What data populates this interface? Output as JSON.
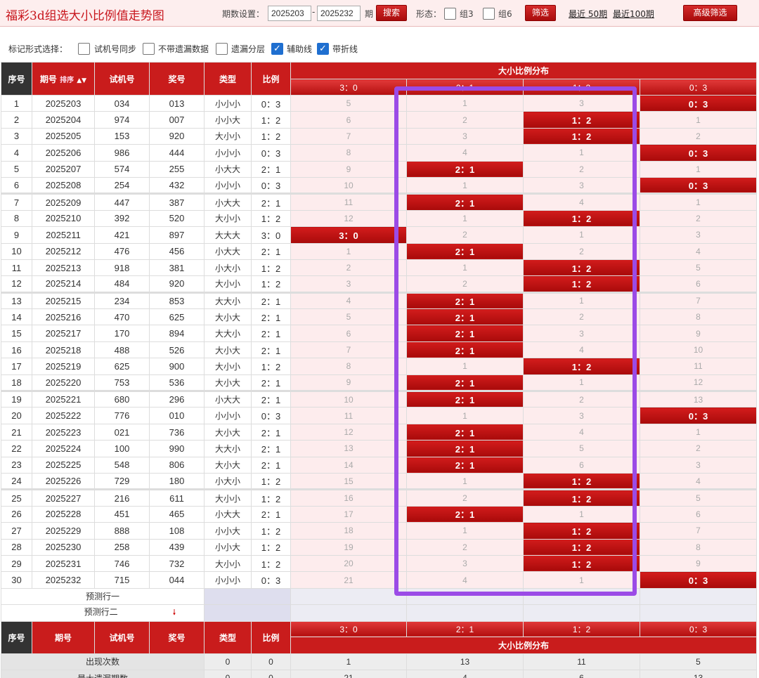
{
  "header": {
    "title": "福彩3d组选大小比例值走势图",
    "period_label": "期数设置：",
    "period_from": "2025203",
    "dash": "-",
    "period_to": "2025232",
    "period_unit": "期",
    "search_label": "搜索",
    "form_label": "形态：",
    "group3_label": "组3",
    "group6_label": "组6",
    "filter_label": "筛选",
    "recent50": "最近 50期",
    "recent100": "最近100期",
    "advanced_label": "高级筛选"
  },
  "options": {
    "label": "标记形式选择：",
    "items": [
      {
        "label": "试机号同步",
        "checked": false
      },
      {
        "label": "不带遗漏数据",
        "checked": false
      },
      {
        "label": "遗漏分层",
        "checked": false
      },
      {
        "label": "辅助线",
        "checked": true
      },
      {
        "label": "带折线",
        "checked": true
      }
    ]
  },
  "table": {
    "headers": {
      "seq": "序号",
      "period": "期号",
      "sort": "排序",
      "test": "试机号",
      "prize": "奖号",
      "type": "类型",
      "ratio": "比例",
      "dist": "大小比例分布"
    },
    "dist_cols": [
      "3：0",
      "2：1",
      "1：2",
      "0：3"
    ],
    "rows": [
      {
        "n": "1",
        "p": "2025203",
        "t": "034",
        "w": "013",
        "k": "小小小",
        "r": "0：3",
        "d": [
          "5",
          "1",
          "3",
          "0：3"
        ],
        "h": 3
      },
      {
        "n": "2",
        "p": "2025204",
        "t": "974",
        "w": "007",
        "k": "小小大",
        "r": "1：2",
        "d": [
          "6",
          "2",
          "1：2",
          "1"
        ],
        "h": 2
      },
      {
        "n": "3",
        "p": "2025205",
        "t": "153",
        "w": "920",
        "k": "大小小",
        "r": "1：2",
        "d": [
          "7",
          "3",
          "1：2",
          "2"
        ],
        "h": 2
      },
      {
        "n": "4",
        "p": "2025206",
        "t": "986",
        "w": "444",
        "k": "小小小",
        "r": "0：3",
        "d": [
          "8",
          "4",
          "1",
          "0：3"
        ],
        "h": 3
      },
      {
        "n": "5",
        "p": "2025207",
        "t": "574",
        "w": "255",
        "k": "小大大",
        "r": "2：1",
        "d": [
          "9",
          "2：1",
          "2",
          "1"
        ],
        "h": 1
      },
      {
        "n": "6",
        "p": "2025208",
        "t": "254",
        "w": "432",
        "k": "小小小",
        "r": "0：3",
        "d": [
          "10",
          "1",
          "3",
          "0：3"
        ],
        "h": 3
      },
      {
        "n": "7",
        "p": "2025209",
        "t": "447",
        "w": "387",
        "k": "小大大",
        "r": "2：1",
        "d": [
          "11",
          "2：1",
          "4",
          "1"
        ],
        "h": 1
      },
      {
        "n": "8",
        "p": "2025210",
        "t": "392",
        "w": "520",
        "k": "大小小",
        "r": "1：2",
        "d": [
          "12",
          "1",
          "1：2",
          "2"
        ],
        "h": 2
      },
      {
        "n": "9",
        "p": "2025211",
        "t": "421",
        "w": "897",
        "k": "大大大",
        "r": "3：0",
        "d": [
          "3：0",
          "2",
          "1",
          "3"
        ],
        "h": 0
      },
      {
        "n": "10",
        "p": "2025212",
        "t": "476",
        "w": "456",
        "k": "小大大",
        "r": "2：1",
        "d": [
          "1",
          "2：1",
          "2",
          "4"
        ],
        "h": 1
      },
      {
        "n": "11",
        "p": "2025213",
        "t": "918",
        "w": "381",
        "k": "小大小",
        "r": "1：2",
        "d": [
          "2",
          "1",
          "1：2",
          "5"
        ],
        "h": 2
      },
      {
        "n": "12",
        "p": "2025214",
        "t": "484",
        "w": "920",
        "k": "大小小",
        "r": "1：2",
        "d": [
          "3",
          "2",
          "1：2",
          "6"
        ],
        "h": 2
      },
      {
        "n": "13",
        "p": "2025215",
        "t": "234",
        "w": "853",
        "k": "大大小",
        "r": "2：1",
        "d": [
          "4",
          "2：1",
          "1",
          "7"
        ],
        "h": 1
      },
      {
        "n": "14",
        "p": "2025216",
        "t": "470",
        "w": "625",
        "k": "大小大",
        "r": "2：1",
        "d": [
          "5",
          "2：1",
          "2",
          "8"
        ],
        "h": 1
      },
      {
        "n": "15",
        "p": "2025217",
        "t": "170",
        "w": "894",
        "k": "大大小",
        "r": "2：1",
        "d": [
          "6",
          "2：1",
          "3",
          "9"
        ],
        "h": 1
      },
      {
        "n": "16",
        "p": "2025218",
        "t": "488",
        "w": "526",
        "k": "大小大",
        "r": "2：1",
        "d": [
          "7",
          "2：1",
          "4",
          "10"
        ],
        "h": 1
      },
      {
        "n": "17",
        "p": "2025219",
        "t": "625",
        "w": "900",
        "k": "大小小",
        "r": "1：2",
        "d": [
          "8",
          "1",
          "1：2",
          "11"
        ],
        "h": 2
      },
      {
        "n": "18",
        "p": "2025220",
        "t": "753",
        "w": "536",
        "k": "大小大",
        "r": "2：1",
        "d": [
          "9",
          "2：1",
          "1",
          "12"
        ],
        "h": 1
      },
      {
        "n": "19",
        "p": "2025221",
        "t": "680",
        "w": "296",
        "k": "小大大",
        "r": "2：1",
        "d": [
          "10",
          "2：1",
          "2",
          "13"
        ],
        "h": 1
      },
      {
        "n": "20",
        "p": "2025222",
        "t": "776",
        "w": "010",
        "k": "小小小",
        "r": "0：3",
        "d": [
          "11",
          "1",
          "3",
          "0：3"
        ],
        "h": 3
      },
      {
        "n": "21",
        "p": "2025223",
        "t": "021",
        "w": "736",
        "k": "大小大",
        "r": "2：1",
        "d": [
          "12",
          "2：1",
          "4",
          "1"
        ],
        "h": 1
      },
      {
        "n": "22",
        "p": "2025224",
        "t": "100",
        "w": "990",
        "k": "大大小",
        "r": "2：1",
        "d": [
          "13",
          "2：1",
          "5",
          "2"
        ],
        "h": 1
      },
      {
        "n": "23",
        "p": "2025225",
        "t": "548",
        "w": "806",
        "k": "大小大",
        "r": "2：1",
        "d": [
          "14",
          "2：1",
          "6",
          "3"
        ],
        "h": 1
      },
      {
        "n": "24",
        "p": "2025226",
        "t": "729",
        "w": "180",
        "k": "小大小",
        "r": "1：2",
        "d": [
          "15",
          "1",
          "1：2",
          "4"
        ],
        "h": 2
      },
      {
        "n": "25",
        "p": "2025227",
        "t": "216",
        "w": "611",
        "k": "大小小",
        "r": "1：2",
        "d": [
          "16",
          "2",
          "1：2",
          "5"
        ],
        "h": 2
      },
      {
        "n": "26",
        "p": "2025228",
        "t": "451",
        "w": "465",
        "k": "小大大",
        "r": "2：1",
        "d": [
          "17",
          "2：1",
          "1",
          "6"
        ],
        "h": 1
      },
      {
        "n": "27",
        "p": "2025229",
        "t": "888",
        "w": "108",
        "k": "小小大",
        "r": "1：2",
        "d": [
          "18",
          "1",
          "1：2",
          "7"
        ],
        "h": 2
      },
      {
        "n": "28",
        "p": "2025230",
        "t": "258",
        "w": "439",
        "k": "小小大",
        "r": "1：2",
        "d": [
          "19",
          "2",
          "1：2",
          "8"
        ],
        "h": 2
      },
      {
        "n": "29",
        "p": "2025231",
        "t": "746",
        "w": "732",
        "k": "大小小",
        "r": "1：2",
        "d": [
          "20",
          "3",
          "1：2",
          "9"
        ],
        "h": 2
      },
      {
        "n": "30",
        "p": "2025232",
        "t": "715",
        "w": "044",
        "k": "小小小",
        "r": "0：3",
        "d": [
          "21",
          "4",
          "1",
          "0：3"
        ],
        "h": 3
      }
    ],
    "predict1": "预测行一",
    "predict2": "预测行二",
    "stats": [
      {
        "label": "出现次数",
        "type": "0",
        "ratio": "0",
        "d": [
          "1",
          "13",
          "11",
          "5"
        ]
      },
      {
        "label": "最大遗漏期数",
        "type": "0",
        "ratio": "0",
        "d": [
          "21",
          "4",
          "6",
          "13"
        ]
      }
    ]
  },
  "colors": {
    "accent": "#c91c1c",
    "highlight_box": "#9b4be6",
    "checked": "#1f6fd0"
  }
}
